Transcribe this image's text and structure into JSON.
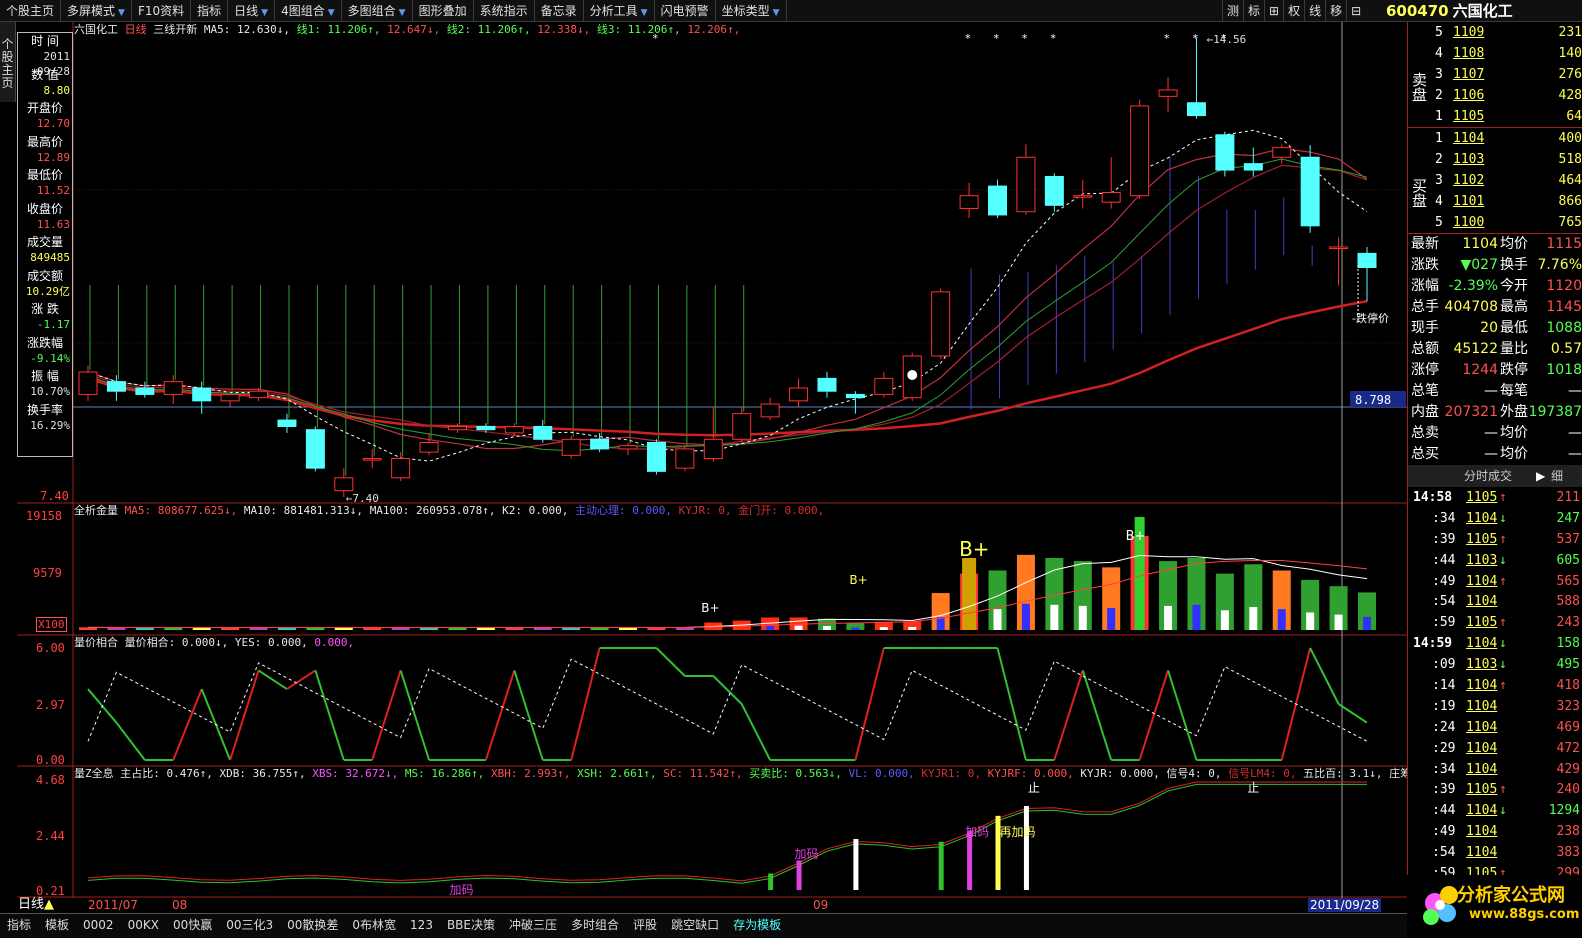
{
  "toolbar": {
    "items": [
      {
        "label": "个股主页",
        "arrow": false
      },
      {
        "label": "多屏模式",
        "arrow": true
      },
      {
        "label": "F10资料",
        "arrow": false
      },
      {
        "label": "指标",
        "arrow": false
      },
      {
        "label": "日线",
        "arrow": true
      },
      {
        "label": "4图组合",
        "arrow": true
      },
      {
        "label": "多图组合",
        "arrow": true
      },
      {
        "label": "图形叠加",
        "arrow": false
      },
      {
        "label": "系统指示",
        "arrow": false
      },
      {
        "label": "备忘录",
        "arrow": false
      },
      {
        "label": "分析工具",
        "arrow": true
      },
      {
        "label": "闪电预警",
        "arrow": false
      },
      {
        "label": "坐标类型",
        "arrow": true
      }
    ],
    "right_items": [
      "测",
      "标",
      "⊞",
      "权",
      "线",
      "移",
      "⊟"
    ]
  },
  "stock": {
    "code": "600470",
    "name": "六国化工",
    "close_icon": "close-icon"
  },
  "side_tab": "个股主页",
  "infobox": {
    "rows": [
      {
        "label": "时 间",
        "value": "2011",
        "value2": "09/28",
        "color": "#e0e0e0"
      },
      {
        "label": "数 值",
        "value": "8.80",
        "color": "#ffff54"
      },
      {
        "label": "开盘价",
        "value": "12.70",
        "color": "#ff5050"
      },
      {
        "label": "最高价",
        "value": "12.89",
        "color": "#ff5050"
      },
      {
        "label": "最低价",
        "value": "11.52",
        "color": "#ff5050"
      },
      {
        "label": "收盘价",
        "value": "11.63",
        "color": "#ff5050"
      },
      {
        "label": "成交量",
        "value": "849485",
        "color": "#ffff54"
      },
      {
        "label": "成交额",
        "value": "10.29亿",
        "color": "#ffff54"
      },
      {
        "label": "涨 跌",
        "value": "-1.17",
        "color": "#54ff54"
      },
      {
        "label": "涨跌幅",
        "value": "-9.14%",
        "color": "#54ff54"
      },
      {
        "label": "振 幅",
        "value": "10.70%",
        "color": "#e0e0e0"
      },
      {
        "label": "换手率",
        "value": "16.29%",
        "color": "#e0e0e0"
      }
    ]
  },
  "price_panel": {
    "title_parts": [
      {
        "t": "六国化工 ",
        "c": "w"
      },
      {
        "t": "日线 ",
        "c": "r"
      },
      {
        "t": "三线开新 MA5: 12.630",
        "c": "w"
      },
      {
        "t": "↓, ",
        "c": "w"
      },
      {
        "t": "线1: 11.206",
        "c": "g"
      },
      {
        "t": "↑, ",
        "c": "g"
      },
      {
        "t": "12.647",
        "c": "r"
      },
      {
        "t": "↓, ",
        "c": "r"
      },
      {
        "t": "线2: 11.206",
        "c": "g"
      },
      {
        "t": "↑, ",
        "c": "g"
      },
      {
        "t": "12.338",
        "c": "r"
      },
      {
        "t": "↓, ",
        "c": "r"
      },
      {
        "t": "线3: 11.206",
        "c": "g"
      },
      {
        "t": "↑, ",
        "c": "g"
      },
      {
        "t": "12.206",
        "c": "r"
      },
      {
        "t": "↑,",
        "c": "r"
      }
    ],
    "axis_top": "14.56",
    "axis_bottom": "7.40",
    "high_label": "14.56",
    "low_label": "7.40",
    "cursor_price": "8.798",
    "limit_label": "跌停价",
    "top_axis_label": "1456"
  },
  "vol_panel": {
    "title_parts": [
      {
        "t": "全析金量 ",
        "c": "w"
      },
      {
        "t": "MA5: 808677.625↓, ",
        "c": "r"
      },
      {
        "t": "MA10: 881481.313↓, ",
        "c": "w"
      },
      {
        "t": "MA100: 260953.078↑, ",
        "c": "w"
      },
      {
        "t": "K2: 0.000, ",
        "c": "w"
      },
      {
        "t": "主动心理: 0.000, ",
        "c": "b"
      },
      {
        "t": "KYJR: 0, ",
        "c": "dr"
      },
      {
        "t": "金门开: 0.000,",
        "c": "dr"
      }
    ],
    "axis": [
      "19158",
      "9579",
      "X100"
    ],
    "markers": [
      "B+",
      "B+",
      "B+",
      "B+"
    ]
  },
  "mid_panel": {
    "title_parts": [
      {
        "t": "量价相合 ",
        "c": "w"
      },
      {
        "t": "量价相合: 0.000↓, ",
        "c": "w"
      },
      {
        "t": "YES: 0.000, ",
        "c": "w"
      },
      {
        "t": "0.000,",
        "c": "m"
      }
    ],
    "axis": [
      "6.00",
      "2.97",
      "0.00"
    ]
  },
  "z_panel": {
    "title_parts": [
      {
        "t": "量Z全息 ",
        "c": "w"
      },
      {
        "t": "主占比: 0.476↑, ",
        "c": "w"
      },
      {
        "t": "XDB: 36.755↑, ",
        "c": "w"
      },
      {
        "t": "XBS: 32.672↓, ",
        "c": "m"
      },
      {
        "t": "MS: 16.286↑, ",
        "c": "g"
      },
      {
        "t": "XBH: 2.993↑, ",
        "c": "r"
      },
      {
        "t": "XSH: 2.661↑, ",
        "c": "g"
      },
      {
        "t": "SC: 11.542↑, ",
        "c": "r"
      },
      {
        "t": "买卖比: 0.563↓, ",
        "c": "g"
      },
      {
        "t": "VL: 0.000, ",
        "c": "b"
      },
      {
        "t": "KYJR1: 0, ",
        "c": "dr"
      },
      {
        "t": "KYJRF: 0.000, ",
        "c": "r"
      },
      {
        "t": "KYJR: 0.000, 信号4: 0, ",
        "c": "w"
      },
      {
        "t": "信号LM4: 0, ",
        "c": "dr"
      },
      {
        "t": "五比百: 3.1↓, 庄筹5比: -0.5↓, ",
        "c": "w"
      },
      {
        "t": "BZ: -9.16",
        "c": "m"
      }
    ],
    "axis": [
      "4.68",
      "2.44",
      "0.21"
    ],
    "annotations": [
      "加码",
      "加码",
      "加码",
      "再加码",
      "止",
      "止"
    ]
  },
  "dates": {
    "d1": "2011/07",
    "d2": "08",
    "d3": "09",
    "d4": "2011/09/28"
  },
  "orderbook": {
    "sell_label": "卖盘",
    "buy_label": "买盘",
    "sell": [
      {
        "lvl": "5",
        "px": "1109",
        "vol": "231"
      },
      {
        "lvl": "4",
        "px": "1108",
        "vol": "140"
      },
      {
        "lvl": "3",
        "px": "1107",
        "vol": "276"
      },
      {
        "lvl": "2",
        "px": "1106",
        "vol": "428"
      },
      {
        "lvl": "1",
        "px": "1105",
        "vol": "64"
      }
    ],
    "buy": [
      {
        "lvl": "1",
        "px": "1104",
        "vol": "400"
      },
      {
        "lvl": "2",
        "px": "1103",
        "vol": "518"
      },
      {
        "lvl": "3",
        "px": "1102",
        "vol": "464"
      },
      {
        "lvl": "4",
        "px": "1101",
        "vol": "866"
      },
      {
        "lvl": "5",
        "px": "1100",
        "vol": "765"
      }
    ]
  },
  "quote": [
    {
      "l1": "最新",
      "v1": "1104",
      "l2": "均价",
      "v2": "1115"
    },
    {
      "l1": "涨跌",
      "v1": "▼027",
      "l2": "换手",
      "v2": "7.76%"
    },
    {
      "l1": "涨幅",
      "v1": "-2.39%",
      "l2": "今开",
      "v2": "1120"
    },
    {
      "l1": "总手",
      "v1": "404708",
      "l2": "最高",
      "v2": "1145"
    },
    {
      "l1": "现手",
      "v1": "20",
      "l2": "最低",
      "v2": "1088"
    },
    {
      "l1": "总额",
      "v1": "45122",
      "l2": "量比",
      "v2": "0.57"
    },
    {
      "l1": "涨停",
      "v1": "1244",
      "l2": "跌停",
      "v2": "1018"
    },
    {
      "l1": "总笔",
      "v1": "—",
      "l2": "每笔",
      "v2": "—"
    },
    {
      "l1": "内盘",
      "v1": "207321",
      "l2": "外盘",
      "v2": "197387"
    },
    {
      "l1": "总卖",
      "v1": "—",
      "l2": "均价",
      "v2": "—"
    },
    {
      "l1": "总买",
      "v1": "—",
      "l2": "均价",
      "v2": "—"
    }
  ],
  "trades_header": {
    "label": "分时成交",
    "btn": "细"
  },
  "trades": [
    {
      "t": "14:58",
      "p": "1105",
      "d": "↑",
      "v": "211"
    },
    {
      "t": ":34",
      "p": "1104",
      "d": "↓",
      "v": "247"
    },
    {
      "t": ":39",
      "p": "1105",
      "d": "↑",
      "v": "537"
    },
    {
      "t": ":44",
      "p": "1103",
      "d": "↓",
      "v": "605"
    },
    {
      "t": ":49",
      "p": "1104",
      "d": "↑",
      "v": "565"
    },
    {
      "t": ":54",
      "p": "1104",
      "d": "",
      "v": "588"
    },
    {
      "t": ":59",
      "p": "1105",
      "d": "↑",
      "v": "243"
    },
    {
      "t": "14:59",
      "p": "1104",
      "d": "↓",
      "v": "158"
    },
    {
      "t": ":09",
      "p": "1103",
      "d": "↓",
      "v": "495"
    },
    {
      "t": ":14",
      "p": "1104",
      "d": "↑",
      "v": "418"
    },
    {
      "t": ":19",
      "p": "1104",
      "d": "",
      "v": "323"
    },
    {
      "t": ":24",
      "p": "1104",
      "d": "",
      "v": "469"
    },
    {
      "t": ":29",
      "p": "1104",
      "d": "",
      "v": "472"
    },
    {
      "t": ":34",
      "p": "1104",
      "d": "",
      "v": "429"
    },
    {
      "t": ":39",
      "p": "1105",
      "d": "↑",
      "v": "240"
    },
    {
      "t": ":44",
      "p": "1104",
      "d": "↓",
      "v": "1294"
    },
    {
      "t": ":49",
      "p": "1104",
      "d": "",
      "v": "238"
    },
    {
      "t": ":54",
      "p": "1104",
      "d": "",
      "v": "383"
    },
    {
      "t": ":59",
      "p": "1105",
      "d": "↑",
      "v": "299"
    }
  ],
  "bottom_tabs": [
    {
      "label": "指标",
      "active": false
    },
    {
      "label": "模板",
      "active": false
    },
    {
      "label": "0002",
      "active": false
    },
    {
      "label": "00KX",
      "active": false
    },
    {
      "label": "00快赢",
      "active": false
    },
    {
      "label": "00三化3",
      "active": false
    },
    {
      "label": "00散换差",
      "active": false
    },
    {
      "label": "0布林宽",
      "active": false
    },
    {
      "label": "123",
      "active": false
    },
    {
      "label": "BBE决策",
      "active": false
    },
    {
      "label": "冲破三压",
      "active": false
    },
    {
      "label": "多时组合",
      "active": false
    },
    {
      "label": "评股",
      "active": false
    },
    {
      "label": "跳空缺口",
      "active": false
    },
    {
      "label": "存为模板",
      "active": true
    }
  ],
  "period_label": "日线",
  "logo": {
    "text": "分析家公式网",
    "url": "www.88gs.com"
  },
  "colors": {
    "up": "#ff3030",
    "down": "#54ffff",
    "ma_red": "#d02020",
    "green": "#30c030",
    "yellow": "#ffff54"
  },
  "chart_data": {
    "type": "candlestick",
    "symbol": "600470",
    "ylim": [
      7.4,
      14.56
    ],
    "candles": [
      {
        "o": 9.0,
        "c": 9.35,
        "h": 9.45,
        "l": 8.9
      },
      {
        "o": 9.2,
        "c": 9.05,
        "h": 9.3,
        "l": 8.9
      },
      {
        "o": 9.1,
        "c": 9.0,
        "h": 9.2,
        "l": 8.95
      },
      {
        "o": 9.0,
        "c": 9.2,
        "h": 9.3,
        "l": 8.85
      },
      {
        "o": 9.1,
        "c": 8.9,
        "h": 9.2,
        "l": 8.7
      },
      {
        "o": 8.9,
        "c": 9.0,
        "h": 9.05,
        "l": 8.8
      },
      {
        "o": 8.95,
        "c": 9.05,
        "h": 9.1,
        "l": 8.9
      },
      {
        "o": 8.6,
        "c": 8.5,
        "h": 8.7,
        "l": 8.4
      },
      {
        "o": 8.45,
        "c": 7.85,
        "h": 8.5,
        "l": 7.8
      },
      {
        "o": 7.5,
        "c": 7.7,
        "h": 7.85,
        "l": 7.4
      },
      {
        "o": 8.0,
        "c": 8.0,
        "h": 8.15,
        "l": 7.85
      },
      {
        "o": 7.7,
        "c": 8.0,
        "h": 8.1,
        "l": 7.65
      },
      {
        "o": 8.1,
        "c": 8.25,
        "h": 8.4,
        "l": 8.05
      },
      {
        "o": 8.45,
        "c": 8.5,
        "h": 8.55,
        "l": 8.4
      },
      {
        "o": 8.5,
        "c": 8.45,
        "h": 8.55,
        "l": 8.4
      },
      {
        "o": 8.4,
        "c": 8.5,
        "h": 8.55,
        "l": 8.35
      },
      {
        "o": 8.5,
        "c": 8.3,
        "h": 8.6,
        "l": 8.25
      },
      {
        "o": 8.05,
        "c": 8.3,
        "h": 8.35,
        "l": 8.0
      },
      {
        "o": 8.3,
        "c": 8.15,
        "h": 8.4,
        "l": 8.1
      },
      {
        "o": 8.15,
        "c": 8.2,
        "h": 8.25,
        "l": 8.05
      },
      {
        "o": 8.25,
        "c": 7.8,
        "h": 8.3,
        "l": 7.75
      },
      {
        "o": 7.85,
        "c": 8.15,
        "h": 8.2,
        "l": 7.8
      },
      {
        "o": 8.0,
        "c": 8.3,
        "h": 8.8,
        "l": 7.95
      },
      {
        "o": 8.3,
        "c": 8.7,
        "h": 8.8,
        "l": 8.25
      },
      {
        "o": 8.65,
        "c": 8.85,
        "h": 8.95,
        "l": 8.6
      },
      {
        "o": 8.9,
        "c": 9.1,
        "h": 9.25,
        "l": 8.8
      },
      {
        "o": 9.25,
        "c": 9.05,
        "h": 9.35,
        "l": 8.95
      },
      {
        "o": 9.0,
        "c": 8.95,
        "h": 9.05,
        "l": 8.7
      },
      {
        "o": 9.0,
        "c": 9.25,
        "h": 9.35,
        "l": 8.95
      },
      {
        "o": 8.95,
        "c": 9.6,
        "h": 9.65,
        "l": 8.9
      },
      {
        "o": 9.6,
        "c": 10.6,
        "h": 10.65,
        "l": 9.55
      },
      {
        "o": 11.9,
        "c": 12.1,
        "h": 12.3,
        "l": 11.75
      },
      {
        "o": 12.25,
        "c": 11.8,
        "h": 12.35,
        "l": 11.75
      },
      {
        "o": 11.85,
        "c": 12.7,
        "h": 12.9,
        "l": 11.8
      },
      {
        "o": 12.4,
        "c": 11.95,
        "h": 12.45,
        "l": 11.85
      },
      {
        "o": 12.1,
        "c": 12.1,
        "h": 12.35,
        "l": 11.9
      },
      {
        "o": 12.0,
        "c": 12.15,
        "h": 12.7,
        "l": 11.9
      },
      {
        "o": 12.1,
        "c": 13.5,
        "h": 13.6,
        "l": 12.05
      },
      {
        "o": 13.65,
        "c": 13.75,
        "h": 13.95,
        "l": 13.4
      },
      {
        "o": 13.55,
        "c": 13.35,
        "h": 14.56,
        "l": 13.3
      },
      {
        "o": 13.05,
        "c": 12.5,
        "h": 13.1,
        "l": 12.4
      },
      {
        "o": 12.6,
        "c": 12.5,
        "h": 12.85,
        "l": 12.4
      },
      {
        "o": 12.7,
        "c": 12.85,
        "h": 12.9,
        "l": 12.6
      },
      {
        "o": 12.7,
        "c": 11.63,
        "h": 12.89,
        "l": 11.52
      },
      {
        "o": 11.3,
        "c": 11.3,
        "h": 11.45,
        "l": 10.7
      },
      {
        "o": 11.2,
        "c": 10.98,
        "h": 11.3,
        "l": 10.45
      }
    ],
    "volume_x100": [
      420,
      380,
      400,
      390,
      410,
      420,
      390,
      400,
      380,
      420,
      400,
      410,
      390,
      380,
      400,
      420,
      410,
      390,
      380,
      400,
      380,
      410,
      1200,
      1500,
      2000,
      2000,
      1800,
      1100,
      1300,
      1400,
      5900,
      9000,
      9500,
      12000,
      11500,
      11000,
      10000,
      15000,
      11000,
      11500,
      9000,
      10500,
      9500,
      8000,
      7000,
      6000
    ]
  }
}
